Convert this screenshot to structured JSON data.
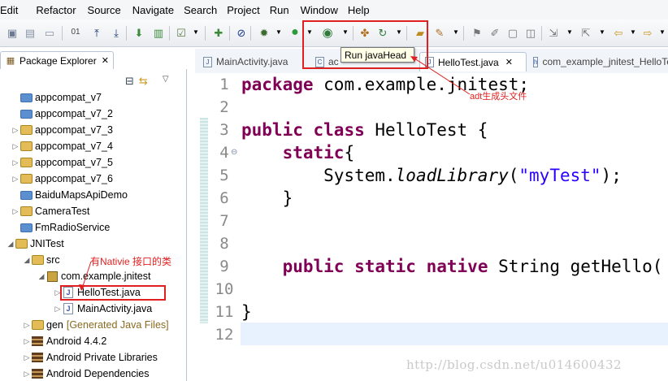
{
  "menu": [
    "Edit",
    "Refactor",
    "Source",
    "Navigate",
    "Search",
    "Project",
    "Run",
    "Window",
    "Help"
  ],
  "tooltip": "Run javaHead",
  "package_explorer": {
    "tab_label": "Package Explorer",
    "items": [
      {
        "label": "appcompat_v7",
        "type": "folder"
      },
      {
        "label": "appcompat_v7_2",
        "type": "folder"
      },
      {
        "label": "appcompat_v7_3",
        "type": "project"
      },
      {
        "label": "appcompat_v7_4",
        "type": "project"
      },
      {
        "label": "appcompat_v7_5",
        "type": "project"
      },
      {
        "label": "appcompat_v7_6",
        "type": "project"
      },
      {
        "label": "BaiduMapsApiDemo",
        "type": "folder"
      },
      {
        "label": "CameraTest",
        "type": "project"
      },
      {
        "label": "FmRadioService",
        "type": "folder"
      },
      {
        "label": "JNITest",
        "type": "project"
      },
      {
        "label": "src",
        "type": "srcfolder"
      },
      {
        "label": "com.example.jnitest",
        "type": "package"
      },
      {
        "label": "HelloTest.java",
        "type": "java"
      },
      {
        "label": "MainActivity.java",
        "type": "java"
      },
      {
        "label": "gen",
        "suffix": "[Generated Java Files]",
        "type": "srcfolder"
      },
      {
        "label": "Android 4.4.2",
        "type": "library"
      },
      {
        "label": "Android Private Libraries",
        "type": "library"
      },
      {
        "label": "Android Dependencies",
        "type": "library"
      }
    ]
  },
  "editor": {
    "tabs": [
      "MainActivity.java",
      "ac",
      "HelloTest.java",
      "com_example_jnitest_HelloTe"
    ],
    "line_numbers": [
      "1",
      "2",
      "3",
      "4",
      "5",
      "6",
      "7",
      "8",
      "9",
      "10",
      "11",
      "12"
    ]
  },
  "annotations": {
    "native_class": "有Nativie 接口的类",
    "adt_header": "adt生成头文件"
  },
  "watermark": "http://blog.csdn.net/u014600432"
}
